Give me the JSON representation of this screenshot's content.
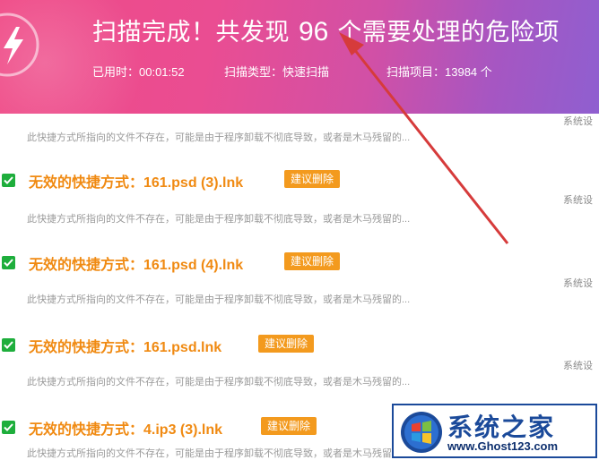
{
  "header": {
    "title_prefix": "扫描完成！共发现",
    "found_count": "96",
    "title_suffix": "个需要处理的危险项",
    "elapsed": "已用时：00:01:52",
    "scan_type": "扫描类型：快速扫描",
    "scan_items": "扫描项目：13984 个"
  },
  "results": {
    "first_desc": "此快捷方式所指向的文件不存在，可能是由于程序卸载不彻底导致，或者是木马残留的...",
    "items": [
      {
        "title": "无效的快捷方式：161.psd (3).lnk",
        "tag": "建议删除",
        "desc": "此快捷方式所指向的文件不存在，可能是由于程序卸载不彻底导致，或者是木马残留的..."
      },
      {
        "title": "无效的快捷方式：161.psd (4).lnk",
        "tag": "建议删除",
        "desc": "此快捷方式所指向的文件不存在，可能是由于程序卸载不彻底导致，或者是木马残留的..."
      },
      {
        "title": "无效的快捷方式：161.psd.lnk",
        "tag": "建议删除",
        "desc": "此快捷方式所指向的文件不存在，可能是由于程序卸载不彻底导致，或者是木马残留的..."
      },
      {
        "title": "无效的快捷方式：4.ip3 (3).lnk",
        "tag": "建议删除",
        "desc": "此快捷方式所指向的文件不存在，可能是由于程序卸载不彻底导致，或者是木马残留的..."
      }
    ],
    "side_labels": [
      "系统设",
      "系统设",
      "系统设",
      "系统设"
    ]
  },
  "watermark": {
    "name": "系统之家",
    "url": "www.Ghost123.com"
  },
  "colors": {
    "header_start": "#ef4a86",
    "header_end": "#8f5fd0",
    "item_title": "#f08a12",
    "tag_bg": "#f39a1e",
    "check": "#1eae3c",
    "annotation_arrow": "#d63b3b"
  },
  "icons": {
    "app": "lightning-bolt-icon",
    "check": "checkbox-checked-icon"
  }
}
